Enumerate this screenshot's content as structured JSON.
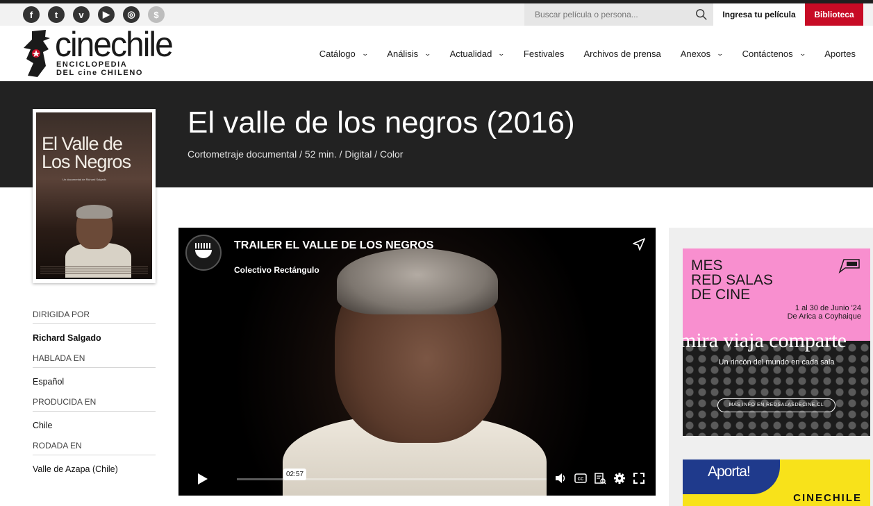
{
  "topbar": {
    "social": [
      {
        "name": "facebook-icon",
        "glyph": "f"
      },
      {
        "name": "twitter-icon",
        "glyph": "t"
      },
      {
        "name": "vimeo-icon",
        "glyph": "v"
      },
      {
        "name": "youtube-icon",
        "glyph": "▶"
      },
      {
        "name": "instagram-icon",
        "glyph": "◎"
      },
      {
        "name": "donate-icon",
        "glyph": "$"
      }
    ],
    "search_placeholder": "Buscar película o persona...",
    "login_label": "Ingresa tu película",
    "library_label": "Biblioteca",
    "library_color": "#c70b25"
  },
  "header": {
    "logo_word": "cinechile",
    "logo_tag1": "ENCICLOPEDIA",
    "logo_tag2": "DEL cine CHILENO",
    "nav": [
      {
        "label": "Catálogo",
        "has_dropdown": true
      },
      {
        "label": "Análisis",
        "has_dropdown": true
      },
      {
        "label": "Actualidad",
        "has_dropdown": true
      },
      {
        "label": "Festivales",
        "has_dropdown": false
      },
      {
        "label": "Archivos de prensa",
        "has_dropdown": false
      },
      {
        "label": "Anexos",
        "has_dropdown": true
      },
      {
        "label": "Contáctenos",
        "has_dropdown": true
      },
      {
        "label": "Aportes",
        "has_dropdown": false
      }
    ]
  },
  "film": {
    "title": "El valle de los negros",
    "year": "(2016)",
    "meta": "Cortometraje documental / 52 min. / Digital / Color",
    "poster": {
      "title": "El Valle de Los Negros",
      "subtitle": "Un documental de Richard Salgado"
    }
  },
  "facts": [
    {
      "label": "DIRIGIDA POR",
      "value": "Richard Salgado",
      "bold": true
    },
    {
      "label": "HABLADA EN",
      "value": "Español",
      "bold": false
    },
    {
      "label": "PRODUCIDA EN",
      "value": "Chile",
      "bold": false
    },
    {
      "label": "RODADA EN",
      "value": "Valle de Azapa (Chile)",
      "bold": false
    }
  ],
  "video": {
    "title": "TRAILER EL VALLE DE LOS NEGROS",
    "channel": "Colectivo Rectángulo",
    "duration": "02:57"
  },
  "ads": {
    "ad1": {
      "heading": "MES\nRED SALAS\nDE CINE",
      "dates_line1": "1 al 30 de Junio '24",
      "dates_line2": "De Arica a Coyhaique",
      "slogan": "mira  viaja  comparte",
      "sub": "Un rincón del mundo en cada sala",
      "more": "MÁS INFO EN REDSALASDECINE.CL",
      "bg_color": "#f88fcf"
    },
    "ad2": {
      "cta": "Aporta!",
      "brand": "CINECHILE",
      "bg_color": "#f8e21a"
    }
  }
}
